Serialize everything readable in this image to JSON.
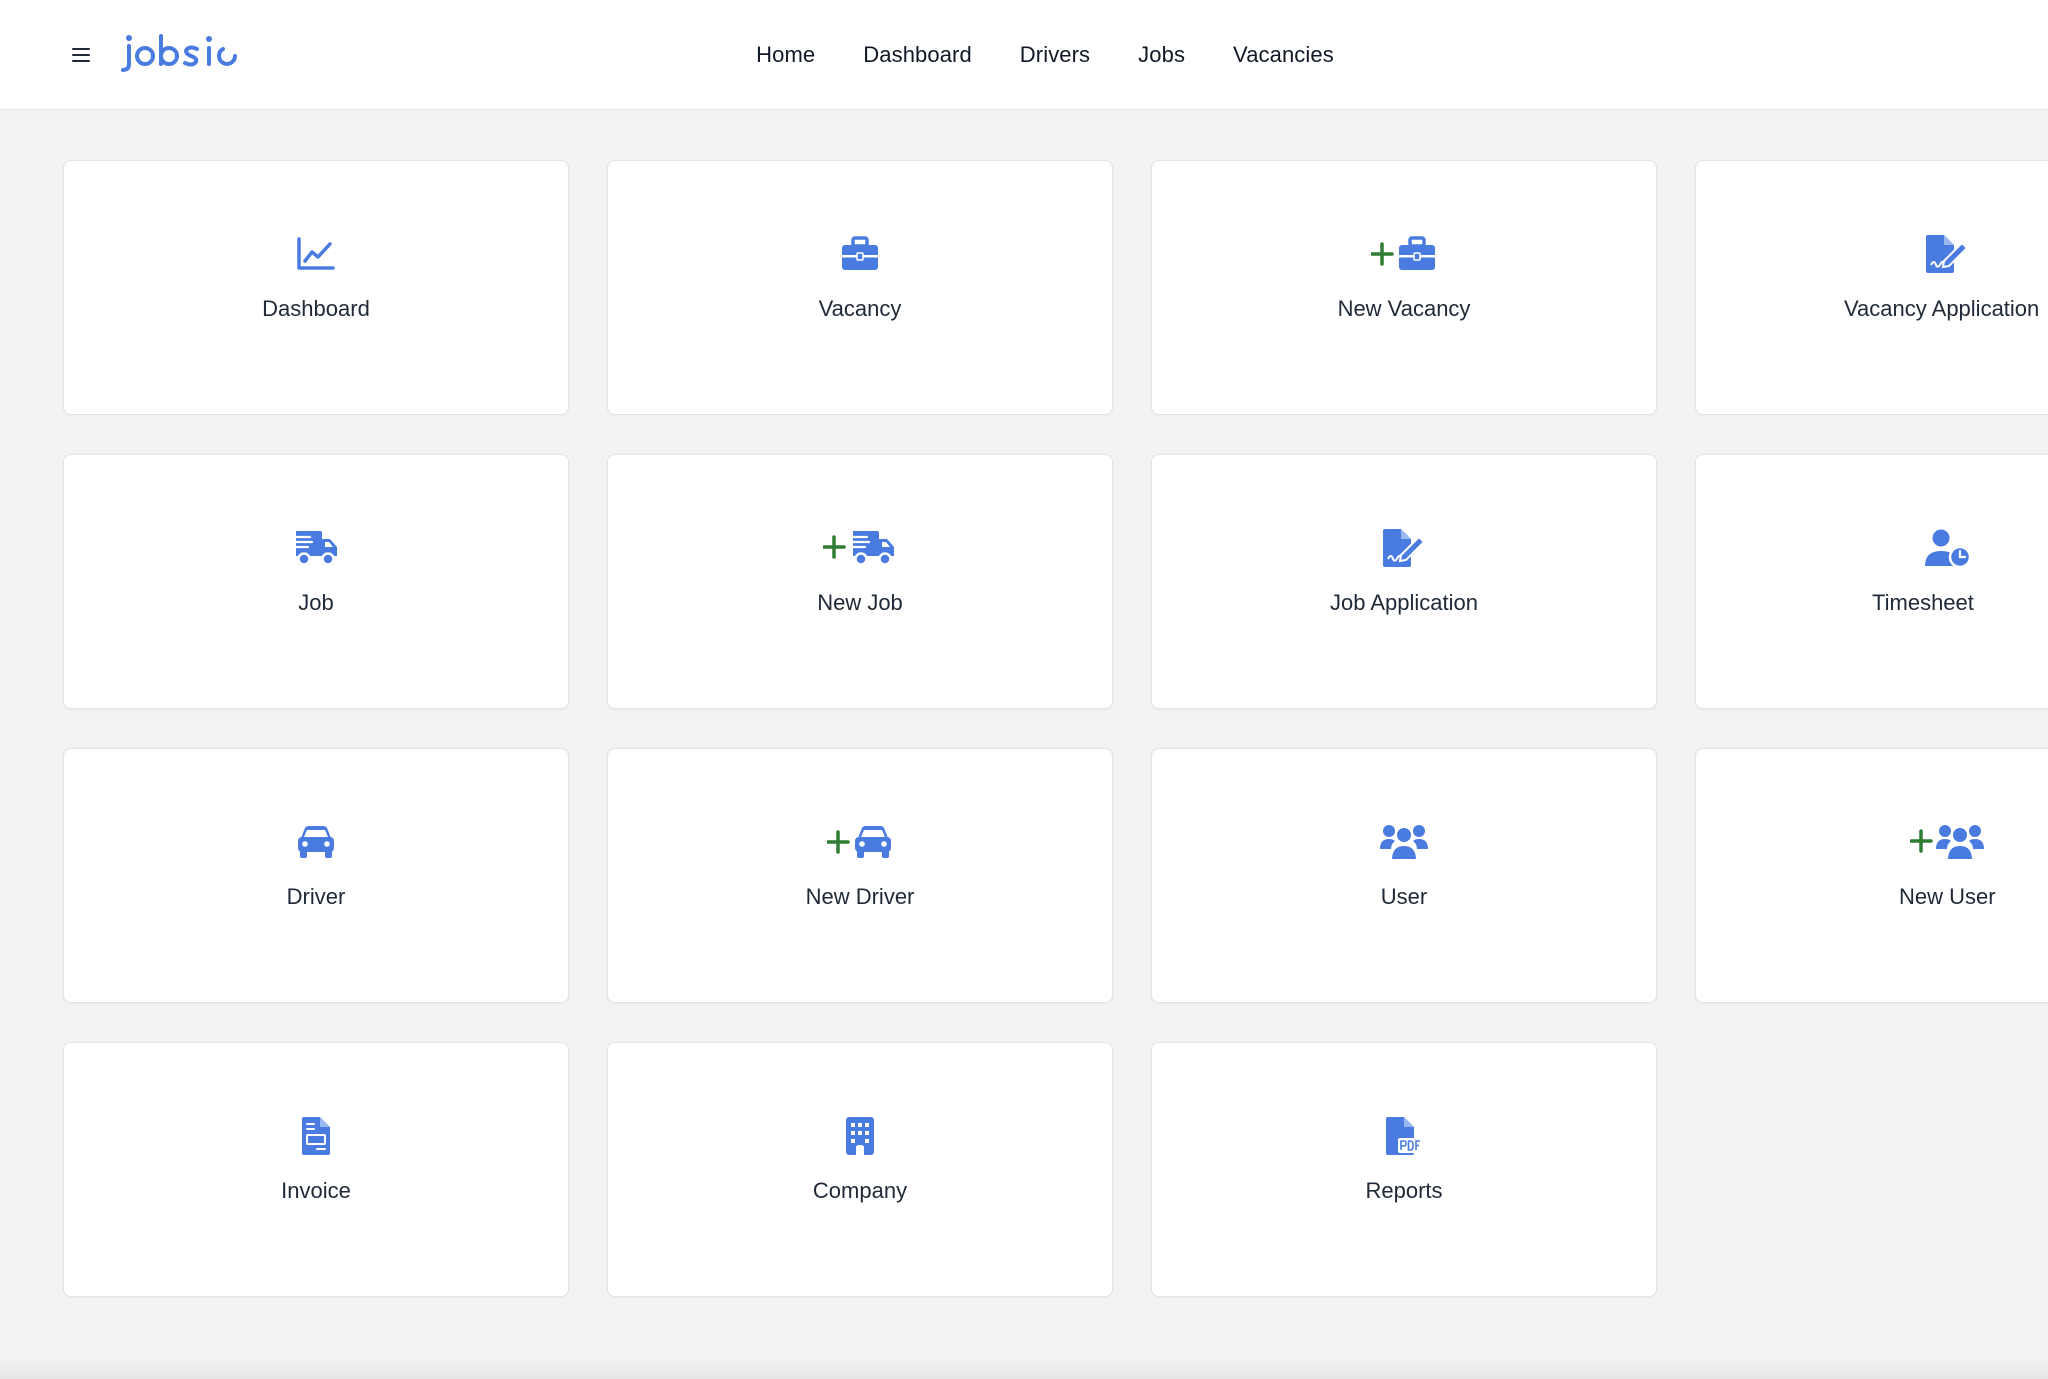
{
  "brand": {
    "logo_text": "jobsio",
    "color": "#4a7be0"
  },
  "colors": {
    "icon": "#4a7be0",
    "plus": "#2e7d32"
  },
  "nav": {
    "items": [
      "Home",
      "Dashboard",
      "Drivers",
      "Jobs",
      "Vacancies"
    ]
  },
  "tiles": [
    {
      "label": "Dashboard",
      "icon": "chart-line-icon"
    },
    {
      "label": "Vacancy",
      "icon": "briefcase-icon"
    },
    {
      "label": "New Vacancy",
      "icon": "plus-briefcase-icon"
    },
    {
      "label": "Vacancy Application",
      "icon": "file-signature-icon"
    },
    {
      "label": "Job",
      "icon": "truck-fast-icon"
    },
    {
      "label": "New Job",
      "icon": "plus-truck-fast-icon"
    },
    {
      "label": "Job Application",
      "icon": "file-signature-icon"
    },
    {
      "label": "Timesheet",
      "icon": "user-clock-icon"
    },
    {
      "label": "Driver",
      "icon": "car-icon"
    },
    {
      "label": "New Driver",
      "icon": "plus-car-icon"
    },
    {
      "label": "User",
      "icon": "users-icon"
    },
    {
      "label": "New User",
      "icon": "plus-users-icon"
    },
    {
      "label": "Invoice",
      "icon": "file-invoice-icon"
    },
    {
      "label": "Company",
      "icon": "building-icon"
    },
    {
      "label": "Reports",
      "icon": "file-pdf-icon"
    }
  ]
}
